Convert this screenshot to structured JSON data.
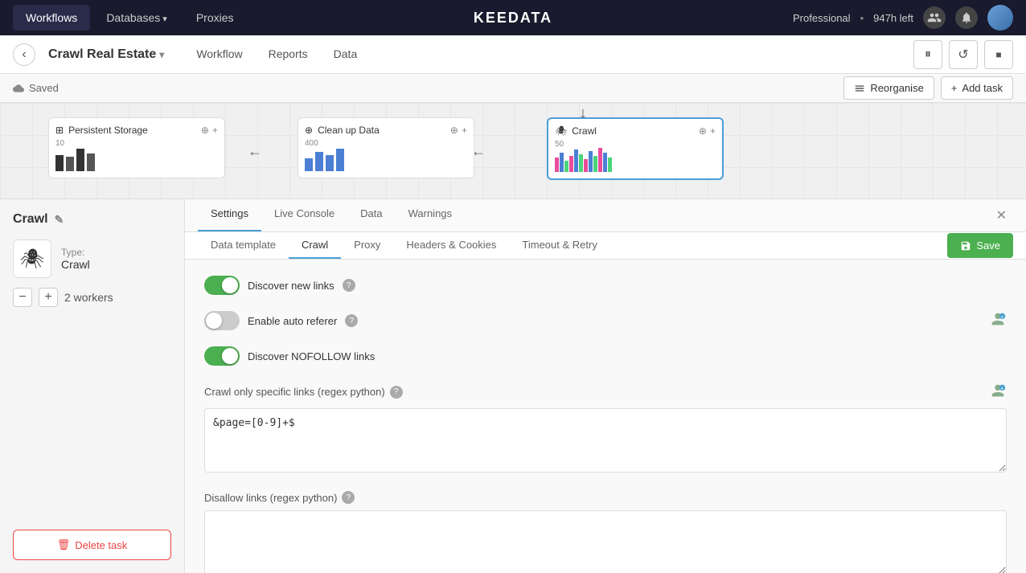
{
  "topNav": {
    "items": [
      {
        "label": "Workflows",
        "active": true
      },
      {
        "label": "Databases",
        "hasArrow": true,
        "active": false
      },
      {
        "label": "Proxies",
        "active": false
      }
    ],
    "brand": "KEEDATA",
    "plan": "Professional",
    "hoursLeft": "947h left"
  },
  "subNav": {
    "projectTitle": "Crawl Real Estate",
    "links": [
      {
        "label": "Workflow"
      },
      {
        "label": "Reports"
      },
      {
        "label": "Data"
      }
    ],
    "controls": {
      "pause": "⏸",
      "refresh": "↺",
      "stop": "■"
    }
  },
  "statusBar": {
    "saved": "Saved",
    "reorganise": "Reorganise",
    "addTask": "Add task"
  },
  "taskCards": [
    {
      "title": "Persistent Storage",
      "icon": "⊞",
      "count": "10"
    },
    {
      "title": "Clean up Data",
      "icon": "⊕",
      "count": "400"
    },
    {
      "title": "Crawl",
      "icon": "🕷",
      "count": "50",
      "active": true
    }
  ],
  "leftPanel": {
    "taskName": "Crawl",
    "type": "Type:",
    "typeValue": "Crawl",
    "workersLabel": "2 workers",
    "deleteLabel": "Delete task"
  },
  "rightPanel": {
    "tabs": [
      {
        "label": "Settings",
        "active": true
      },
      {
        "label": "Live Console"
      },
      {
        "label": "Data"
      },
      {
        "label": "Warnings"
      }
    ],
    "subTabs": [
      {
        "label": "Data template"
      },
      {
        "label": "Crawl",
        "active": true
      },
      {
        "label": "Proxy"
      },
      {
        "label": "Headers & Cookies"
      },
      {
        "label": "Timeout & Retry"
      }
    ],
    "saveLabel": "Save",
    "settings": {
      "discoverNewLinks": "Discover new links",
      "enableAutoReferer": "Enable auto referer",
      "discoverNofollow": "Discover NOFOLLOW links",
      "crawlSpecificLabel": "Crawl only specific links (regex python)",
      "crawlSpecificValue": "&page=[0-9]+$",
      "disallowLabel": "Disallow links (regex python)",
      "disallowValue": ""
    },
    "toggles": {
      "discoverNewLinks": "on",
      "enableAutoReferer": "off",
      "discoverNofollow": "on"
    }
  }
}
